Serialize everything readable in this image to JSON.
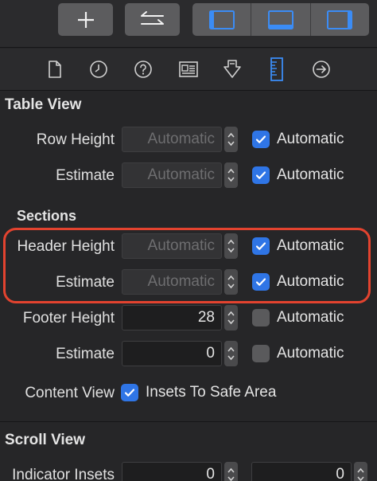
{
  "table_view": {
    "title": "Table View",
    "row_height": {
      "label": "Row Height",
      "placeholder": "Automatic",
      "checkbox_label": "Automatic",
      "checked": true
    },
    "row_estimate": {
      "label": "Estimate",
      "placeholder": "Automatic",
      "checkbox_label": "Automatic",
      "checked": true
    }
  },
  "sections": {
    "title": "Sections",
    "header_height": {
      "label": "Header Height",
      "placeholder": "Automatic",
      "checkbox_label": "Automatic",
      "checked": true
    },
    "header_estimate": {
      "label": "Estimate",
      "placeholder": "Automatic",
      "checkbox_label": "Automatic",
      "checked": true
    },
    "footer_height": {
      "label": "Footer Height",
      "value": "28",
      "checkbox_label": "Automatic",
      "checked": false
    },
    "footer_estimate": {
      "label": "Estimate",
      "value": "0",
      "checkbox_label": "Automatic",
      "checked": false
    },
    "content_view": {
      "label": "Content View",
      "checkbox_label": "Insets To Safe Area",
      "checked": true
    }
  },
  "scroll_view": {
    "title": "Scroll View",
    "indicator_insets": {
      "label": "Indicator Insets",
      "value_left": "0",
      "value_right": "0"
    }
  },
  "colors": {
    "accent": "#2f75e6",
    "highlight": "#e3432f",
    "active_tab": "#3b8cf5"
  },
  "icons": {
    "toolbar": [
      "plus-icon",
      "swap-arrows-icon",
      "left-panel-icon",
      "bottom-panel-icon",
      "right-panel-icon"
    ],
    "tabs": [
      "file-inspector-icon",
      "history-inspector-icon",
      "help-inspector-icon",
      "identity-inspector-icon",
      "attributes-inspector-icon",
      "size-inspector-icon",
      "connections-inspector-icon"
    ]
  }
}
